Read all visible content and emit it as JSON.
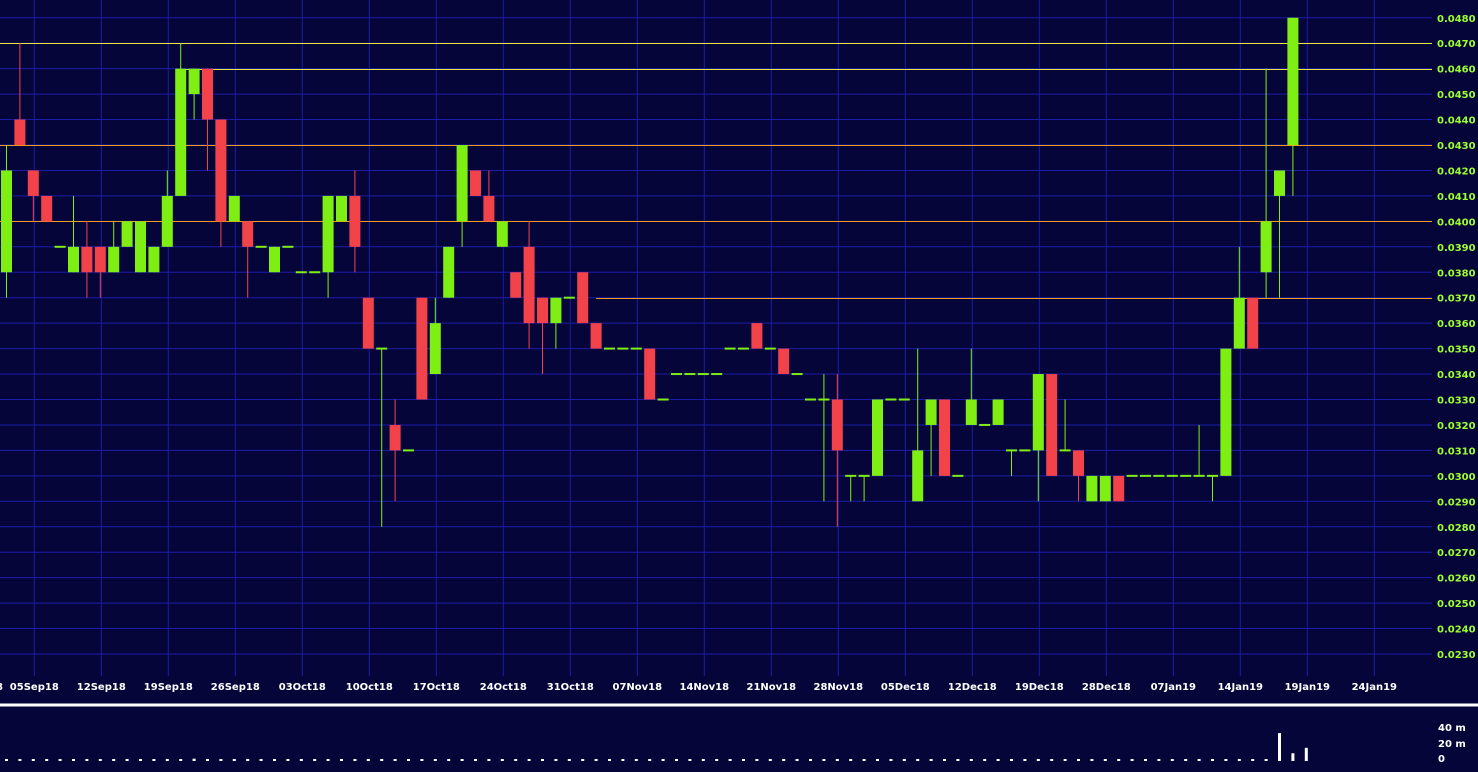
{
  "colors": {
    "background": "#05053a",
    "grid": "#1c1ca8",
    "up": "#7fef13",
    "down": "#f2434a",
    "price_axis_label": "#9cff2e",
    "date_axis_label": "#ffffff",
    "divider": "#ffffff",
    "resistance_line": "#e8e83a",
    "support_line": "#f29a1a",
    "volume_bar": "#ffffff"
  },
  "chart_data": [
    {
      "type": "candlestick",
      "panel": "price",
      "y_ticks": [
        "0.0230",
        "0.0240",
        "0.0250",
        "0.0260",
        "0.0270",
        "0.0280",
        "0.0290",
        "0.0300",
        "0.0310",
        "0.0320",
        "0.0330",
        "0.0340",
        "0.0350",
        "0.0360",
        "0.0370",
        "0.0380",
        "0.0390",
        "0.0400",
        "0.0410",
        "0.0420",
        "0.0430",
        "0.0440",
        "0.0450",
        "0.0460",
        "0.0470",
        "0.0480"
      ],
      "ylim": [
        0.0221,
        0.0484
      ],
      "x_ticks": [
        "05Sep18",
        "12Sep18",
        "19Sep18",
        "26Sep18",
        "03Oct18",
        "10Oct18",
        "17Oct18",
        "24Oct18",
        "31Oct18",
        "07Nov18",
        "14Nov18",
        "21Nov18",
        "28Nov18",
        "05Dec18",
        "12Dec18",
        "19Dec18",
        "28Dec18",
        "07Jan19",
        "14Jan19",
        "19Jan19",
        "24Jan19"
      ],
      "x_tick_index": [
        2,
        7,
        12,
        17,
        22,
        27,
        32,
        37,
        42,
        47,
        52,
        57,
        62,
        67,
        72,
        77,
        82,
        87,
        92,
        97,
        102
      ],
      "left_edge_label": "8",
      "grid": true,
      "horizontal_levels": [
        {
          "price": 0.047,
          "kind": "resistance",
          "from_index": 0
        },
        {
          "price": 0.046,
          "kind": "resistance",
          "from_index": 13
        },
        {
          "price": 0.043,
          "kind": "support",
          "from_index": 0
        },
        {
          "price": 0.04,
          "kind": "support",
          "from_index": 0
        },
        {
          "price": 0.037,
          "kind": "support",
          "from_index": 44
        }
      ],
      "candles": [
        {
          "o": 0.038,
          "h": 0.043,
          "l": 0.037,
          "c": 0.042
        },
        {
          "o": 0.044,
          "h": 0.047,
          "l": 0.043,
          "c": 0.043
        },
        {
          "o": 0.042,
          "h": 0.042,
          "l": 0.04,
          "c": 0.041
        },
        {
          "o": 0.041,
          "h": 0.041,
          "l": 0.04,
          "c": 0.04
        },
        {
          "o": 0.039,
          "h": 0.039,
          "l": 0.039,
          "c": 0.039
        },
        {
          "o": 0.038,
          "h": 0.041,
          "l": 0.038,
          "c": 0.039
        },
        {
          "o": 0.039,
          "h": 0.04,
          "l": 0.037,
          "c": 0.038
        },
        {
          "o": 0.039,
          "h": 0.039,
          "l": 0.037,
          "c": 0.038
        },
        {
          "o": 0.038,
          "h": 0.04,
          "l": 0.038,
          "c": 0.039
        },
        {
          "o": 0.039,
          "h": 0.04,
          "l": 0.039,
          "c": 0.04
        },
        {
          "o": 0.038,
          "h": 0.04,
          "l": 0.038,
          "c": 0.04
        },
        {
          "o": 0.038,
          "h": 0.039,
          "l": 0.038,
          "c": 0.039
        },
        {
          "o": 0.039,
          "h": 0.042,
          "l": 0.039,
          "c": 0.041
        },
        {
          "o": 0.041,
          "h": 0.047,
          "l": 0.041,
          "c": 0.046
        },
        {
          "o": 0.045,
          "h": 0.046,
          "l": 0.044,
          "c": 0.046
        },
        {
          "o": 0.046,
          "h": 0.046,
          "l": 0.042,
          "c": 0.044
        },
        {
          "o": 0.044,
          "h": 0.044,
          "l": 0.039,
          "c": 0.04
        },
        {
          "o": 0.04,
          "h": 0.041,
          "l": 0.04,
          "c": 0.041
        },
        {
          "o": 0.04,
          "h": 0.04,
          "l": 0.037,
          "c": 0.039
        },
        {
          "o": 0.039,
          "h": 0.039,
          "l": 0.039,
          "c": 0.039
        },
        {
          "o": 0.038,
          "h": 0.039,
          "l": 0.038,
          "c": 0.039
        },
        {
          "o": 0.039,
          "h": 0.039,
          "l": 0.039,
          "c": 0.039
        },
        {
          "o": 0.038,
          "h": 0.038,
          "l": 0.038,
          "c": 0.038
        },
        {
          "o": 0.038,
          "h": 0.038,
          "l": 0.038,
          "c": 0.038
        },
        {
          "o": 0.038,
          "h": 0.041,
          "l": 0.037,
          "c": 0.041
        },
        {
          "o": 0.04,
          "h": 0.041,
          "l": 0.04,
          "c": 0.041
        },
        {
          "o": 0.041,
          "h": 0.042,
          "l": 0.038,
          "c": 0.039
        },
        {
          "o": 0.037,
          "h": 0.037,
          "l": 0.035,
          "c": 0.035
        },
        {
          "o": 0.035,
          "h": 0.035,
          "l": 0.028,
          "c": 0.035
        },
        {
          "o": 0.032,
          "h": 0.033,
          "l": 0.029,
          "c": 0.031
        },
        {
          "o": 0.031,
          "h": 0.031,
          "l": 0.031,
          "c": 0.031
        },
        {
          "o": 0.037,
          "h": 0.037,
          "l": 0.033,
          "c": 0.033
        },
        {
          "o": 0.034,
          "h": 0.037,
          "l": 0.034,
          "c": 0.036
        },
        {
          "o": 0.037,
          "h": 0.039,
          "l": 0.037,
          "c": 0.039
        },
        {
          "o": 0.04,
          "h": 0.043,
          "l": 0.039,
          "c": 0.043
        },
        {
          "o": 0.042,
          "h": 0.042,
          "l": 0.041,
          "c": 0.041
        },
        {
          "o": 0.041,
          "h": 0.042,
          "l": 0.04,
          "c": 0.04
        },
        {
          "o": 0.039,
          "h": 0.04,
          "l": 0.039,
          "c": 0.04
        },
        {
          "o": 0.038,
          "h": 0.038,
          "l": 0.037,
          "c": 0.037
        },
        {
          "o": 0.039,
          "h": 0.04,
          "l": 0.035,
          "c": 0.036
        },
        {
          "o": 0.037,
          "h": 0.037,
          "l": 0.034,
          "c": 0.036
        },
        {
          "o": 0.036,
          "h": 0.037,
          "l": 0.035,
          "c": 0.037
        },
        {
          "o": 0.037,
          "h": 0.037,
          "l": 0.037,
          "c": 0.037
        },
        {
          "o": 0.038,
          "h": 0.038,
          "l": 0.036,
          "c": 0.036
        },
        {
          "o": 0.036,
          "h": 0.036,
          "l": 0.035,
          "c": 0.035
        },
        {
          "o": 0.035,
          "h": 0.035,
          "l": 0.035,
          "c": 0.035
        },
        {
          "o": 0.035,
          "h": 0.035,
          "l": 0.035,
          "c": 0.035
        },
        {
          "o": 0.035,
          "h": 0.035,
          "l": 0.035,
          "c": 0.035
        },
        {
          "o": 0.035,
          "h": 0.035,
          "l": 0.033,
          "c": 0.033
        },
        {
          "o": 0.033,
          "h": 0.033,
          "l": 0.033,
          "c": 0.033
        },
        {
          "o": 0.034,
          "h": 0.034,
          "l": 0.034,
          "c": 0.034
        },
        {
          "o": 0.034,
          "h": 0.034,
          "l": 0.034,
          "c": 0.034
        },
        {
          "o": 0.034,
          "h": 0.034,
          "l": 0.034,
          "c": 0.034
        },
        {
          "o": 0.034,
          "h": 0.034,
          "l": 0.034,
          "c": 0.034
        },
        {
          "o": 0.035,
          "h": 0.035,
          "l": 0.035,
          "c": 0.035
        },
        {
          "o": 0.035,
          "h": 0.035,
          "l": 0.035,
          "c": 0.035
        },
        {
          "o": 0.036,
          "h": 0.036,
          "l": 0.035,
          "c": 0.035
        },
        {
          "o": 0.035,
          "h": 0.035,
          "l": 0.035,
          "c": 0.035
        },
        {
          "o": 0.035,
          "h": 0.035,
          "l": 0.034,
          "c": 0.034
        },
        {
          "o": 0.034,
          "h": 0.034,
          "l": 0.034,
          "c": 0.034
        },
        {
          "o": 0.033,
          "h": 0.033,
          "l": 0.033,
          "c": 0.033
        },
        {
          "o": 0.033,
          "h": 0.034,
          "l": 0.029,
          "c": 0.033
        },
        {
          "o": 0.033,
          "h": 0.034,
          "l": 0.028,
          "c": 0.031
        },
        {
          "o": 0.03,
          "h": 0.03,
          "l": 0.029,
          "c": 0.03
        },
        {
          "o": 0.03,
          "h": 0.03,
          "l": 0.029,
          "c": 0.03
        },
        {
          "o": 0.03,
          "h": 0.033,
          "l": 0.03,
          "c": 0.033
        },
        {
          "o": 0.033,
          "h": 0.033,
          "l": 0.033,
          "c": 0.033
        },
        {
          "o": 0.033,
          "h": 0.033,
          "l": 0.033,
          "c": 0.033
        },
        {
          "o": 0.029,
          "h": 0.035,
          "l": 0.029,
          "c": 0.031
        },
        {
          "o": 0.032,
          "h": 0.033,
          "l": 0.03,
          "c": 0.033
        },
        {
          "o": 0.033,
          "h": 0.033,
          "l": 0.03,
          "c": 0.03
        },
        {
          "o": 0.03,
          "h": 0.03,
          "l": 0.03,
          "c": 0.03
        },
        {
          "o": 0.032,
          "h": 0.035,
          "l": 0.032,
          "c": 0.033
        },
        {
          "o": 0.032,
          "h": 0.032,
          "l": 0.032,
          "c": 0.032
        },
        {
          "o": 0.032,
          "h": 0.033,
          "l": 0.032,
          "c": 0.033
        },
        {
          "o": 0.031,
          "h": 0.031,
          "l": 0.03,
          "c": 0.031
        },
        {
          "o": 0.031,
          "h": 0.031,
          "l": 0.031,
          "c": 0.031
        },
        {
          "o": 0.031,
          "h": 0.034,
          "l": 0.029,
          "c": 0.034
        },
        {
          "o": 0.034,
          "h": 0.034,
          "l": 0.03,
          "c": 0.03
        },
        {
          "o": 0.031,
          "h": 0.033,
          "l": 0.031,
          "c": 0.031
        },
        {
          "o": 0.031,
          "h": 0.031,
          "l": 0.029,
          "c": 0.03
        },
        {
          "o": 0.029,
          "h": 0.03,
          "l": 0.029,
          "c": 0.03
        },
        {
          "o": 0.029,
          "h": 0.03,
          "l": 0.029,
          "c": 0.03
        },
        {
          "o": 0.03,
          "h": 0.03,
          "l": 0.029,
          "c": 0.029
        },
        {
          "o": 0.03,
          "h": 0.03,
          "l": 0.03,
          "c": 0.03
        },
        {
          "o": 0.03,
          "h": 0.03,
          "l": 0.03,
          "c": 0.03
        },
        {
          "o": 0.03,
          "h": 0.03,
          "l": 0.03,
          "c": 0.03
        },
        {
          "o": 0.03,
          "h": 0.03,
          "l": 0.03,
          "c": 0.03
        },
        {
          "o": 0.03,
          "h": 0.03,
          "l": 0.03,
          "c": 0.03
        },
        {
          "o": 0.03,
          "h": 0.032,
          "l": 0.03,
          "c": 0.03
        },
        {
          "o": 0.03,
          "h": 0.03,
          "l": 0.029,
          "c": 0.03
        },
        {
          "o": 0.03,
          "h": 0.035,
          "l": 0.03,
          "c": 0.035
        },
        {
          "o": 0.035,
          "h": 0.039,
          "l": 0.035,
          "c": 0.037
        },
        {
          "o": 0.037,
          "h": 0.037,
          "l": 0.035,
          "c": 0.035
        },
        {
          "o": 0.038,
          "h": 0.046,
          "l": 0.037,
          "c": 0.04
        },
        {
          "o": 0.041,
          "h": 0.042,
          "l": 0.037,
          "c": 0.042
        },
        {
          "o": 0.043,
          "h": 0.048,
          "l": 0.041,
          "c": 0.048
        }
      ]
    },
    {
      "type": "bar",
      "panel": "volume",
      "y_ticks": [
        "40 m",
        "20 m",
        "0"
      ],
      "ylim": [
        0,
        40
      ],
      "unit": "million",
      "values": [
        1,
        0.5,
        0.5,
        0.5,
        0.5,
        0.5,
        0.5,
        0.5,
        2,
        0.5,
        0.5,
        2,
        0.5,
        0.5,
        3,
        0.5,
        0.5,
        0.5,
        0.5,
        0.5,
        0.5,
        0.5,
        0.5,
        0.5,
        0.5,
        0.5,
        0.5,
        0.5,
        2,
        0.5,
        0.5,
        0.5,
        0.5,
        2,
        0.5,
        0.5,
        0.5,
        0.5,
        0.5,
        2,
        0.5,
        0.5,
        0.5,
        0.5,
        0.5,
        0.5,
        0.5,
        0.5,
        0.5,
        0.5,
        0.5,
        0.5,
        0.5,
        0.5,
        0.5,
        0.5,
        0.5,
        0.5,
        0.5,
        0.5,
        0.5,
        0.5,
        0.5,
        0.5,
        0.5,
        0.5,
        0.5,
        0.5,
        0.5,
        0.5,
        0.5,
        0.5,
        0.5,
        0.5,
        0.5,
        0.5,
        0.5,
        0.5,
        0.5,
        0.5,
        0.5,
        0.5,
        0.5,
        0.5,
        0.5,
        0.5,
        0.5,
        0.5,
        0.5,
        0.5,
        2,
        2,
        0.5,
        0.5,
        0.5,
        36,
        10,
        17
      ]
    }
  ]
}
